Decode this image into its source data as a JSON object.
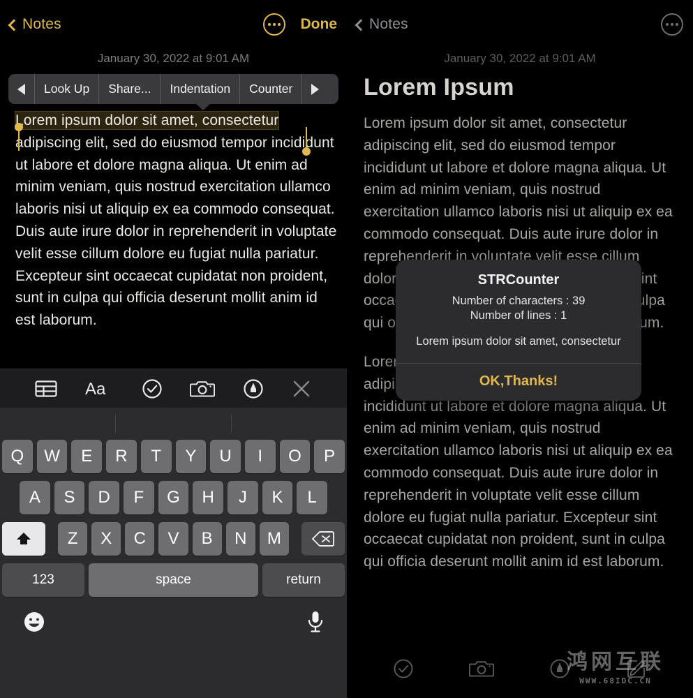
{
  "left": {
    "nav": {
      "back_label": "Notes",
      "back_icon": "chevron-left-icon",
      "more_icon": "ellipsis-circle-icon",
      "done_label": "Done"
    },
    "date": "January 30, 2022 at 9:01 AM",
    "callout": {
      "prev_icon": "triangle-left-icon",
      "next_icon": "triangle-right-icon",
      "items": [
        "Look Up",
        "Share...",
        "Indentation",
        "Counter"
      ]
    },
    "note": {
      "selected_text": "Lorem ipsum dolor sit amet, consectetur",
      "rest_text": " adipiscing elit, sed do eiusmod tempor incididunt ut labore et dolore magna aliqua. Ut enim ad minim veniam, quis nostrud exercitation ullamco laboris nisi ut aliquip ex ea commodo consequat. Duis aute irure dolor in reprehenderit in voluptate velit esse cillum dolore eu fugiat nulla pariatur. Excepteur sint occaecat cupidatat non proident, sunt in culpa qui officia deserunt mollit anim id est laborum."
    },
    "format_toolbar": {
      "icons": [
        "table-icon",
        "text-format-icon",
        "checklist-icon",
        "camera-icon",
        "markup-pen-icon",
        "close-icon"
      ]
    },
    "keyboard": {
      "predictive": [
        "",
        "",
        ""
      ],
      "row1": [
        "Q",
        "W",
        "E",
        "R",
        "T",
        "Y",
        "U",
        "I",
        "O",
        "P"
      ],
      "row2": [
        "A",
        "S",
        "D",
        "F",
        "G",
        "H",
        "J",
        "K",
        "L"
      ],
      "row3_shift_icon": "shift-up-arrow-icon",
      "row3": [
        "Z",
        "X",
        "C",
        "V",
        "B",
        "N",
        "M"
      ],
      "row3_delete_icon": "backspace-icon",
      "num_label": "123",
      "space_label": "space",
      "return_label": "return",
      "emoji_icon": "smiley-face-icon",
      "mic_icon": "microphone-icon"
    }
  },
  "right": {
    "nav": {
      "back_label": "Notes",
      "back_icon": "chevron-left-icon",
      "more_icon": "ellipsis-circle-icon"
    },
    "date": "January 30, 2022 at 9:01 AM",
    "title": "Lorem Ipsum",
    "body": "Lorem ipsum dolor sit amet, consectetur adipiscing elit, sed do eiusmod tempor incididunt ut labore et dolore magna aliqua. Ut enim ad minim veniam, quis nostrud exercitation ullamco laboris nisi ut aliquip ex ea commodo consequat. Duis aute irure dolor in reprehenderit in voluptate velit esse cillum dolore eu fugiat nulla pariatur. Excepteur sint occaecat cupidatat non proident, sunt in culpa qui officia deserunt mollit anim id est laborum.",
    "body2": "Lorem ipsum dolor sit amet, consectetur adipiscing elit, sed do eiusmod tempor incididunt ut labore et dolore magna aliqua. Ut enim ad minim veniam, quis nostrud exercitation ullamco laboris nisi ut aliquip ex ea commodo consequat. Duis aute irure dolor in reprehenderit in voluptate velit esse cillum dolore eu fugiat nulla pariatur. Excepteur sint occaecat cupidatat non proident, sunt in culpa qui officia deserunt mollit anim id est laborum.",
    "alert": {
      "title": "STRCounter",
      "line_characters": "Number of characters : 39",
      "line_lines": "Number of lines : 1",
      "message": "Lorem ipsum dolor sit amet, consectetur",
      "action_label": "OK,Thanks!"
    },
    "bottom_toolbar": {
      "icons": [
        "checklist-icon",
        "camera-icon",
        "markup-pen-icon",
        "compose-icon"
      ]
    }
  },
  "watermark": {
    "text_cn": "鸿网互联",
    "url": "WWW.68IDC.CN"
  },
  "colors": {
    "accent_gold": "#e0b84d",
    "background": "#000000",
    "keyboard_bg": "#2c2c2e",
    "key_fill": "#6e6e70",
    "alert_bg": "#2c2c2e"
  }
}
